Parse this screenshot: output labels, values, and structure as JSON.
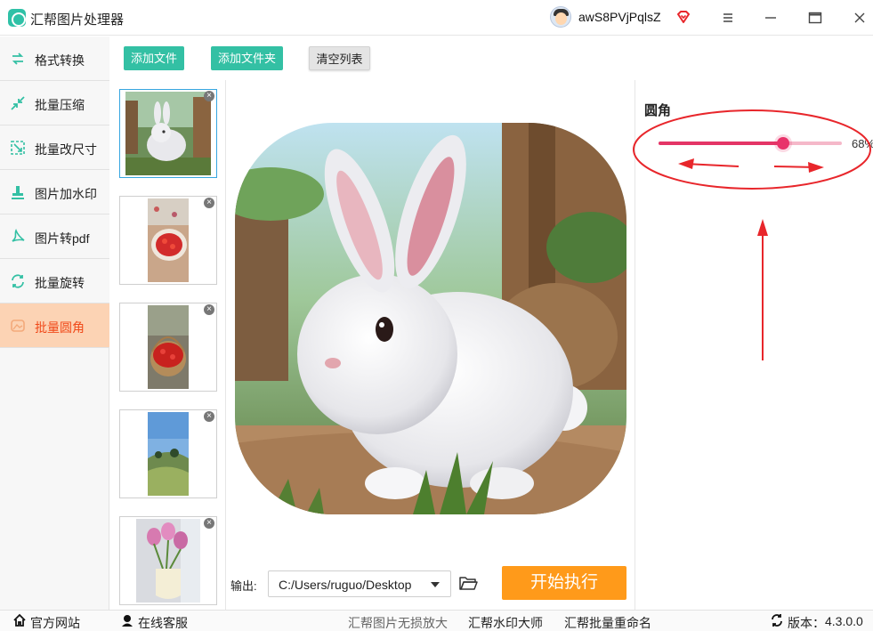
{
  "app": {
    "title": "汇帮图片处理器",
    "username": "awS8PVjPqlsZ"
  },
  "sidebar": {
    "items": [
      {
        "label": "格式转换",
        "icon": "format-convert-icon",
        "active": false
      },
      {
        "label": "批量压缩",
        "icon": "compress-icon",
        "active": false
      },
      {
        "label": "批量改尺寸",
        "icon": "resize-icon",
        "active": false
      },
      {
        "label": "图片加水印",
        "icon": "watermark-icon",
        "active": false
      },
      {
        "label": "图片转pdf",
        "icon": "pdf-icon",
        "active": false
      },
      {
        "label": "批量旋转",
        "icon": "rotate-icon",
        "active": false
      },
      {
        "label": "批量圆角",
        "icon": "round-corner-icon",
        "active": true
      }
    ]
  },
  "toolbar": {
    "add_file": "添加文件",
    "add_folder": "添加文件夹",
    "clear_list": "清空列表"
  },
  "thumbnails": [
    {
      "subject": "rabbit",
      "selected": true
    },
    {
      "subject": "strawberries-plate",
      "selected": false
    },
    {
      "subject": "strawberries-basket",
      "selected": false
    },
    {
      "subject": "hill-landscape",
      "selected": false
    },
    {
      "subject": "tulips-vase",
      "selected": false
    }
  ],
  "output": {
    "label": "输出:",
    "path": "C:/Users/ruguo/Desktop"
  },
  "run_button": "开始执行",
  "settings": {
    "title": "圆角",
    "corner_percent": 68,
    "value_text": "68%"
  },
  "footer": {
    "website": "官方网站",
    "support": "在线客服",
    "link_upscale": "汇帮图片无损放大",
    "link_watermark": "汇帮水印大师",
    "link_rename": "汇帮批量重命名",
    "version_label": "版本：",
    "version": "4.3.0.0"
  },
  "colors": {
    "accent_green": "#33c0a4",
    "run_orange": "#ff9a1a",
    "active_sidebar": "#fcd3b4",
    "slider": "#e43566",
    "annotation_red": "#e8262b"
  }
}
